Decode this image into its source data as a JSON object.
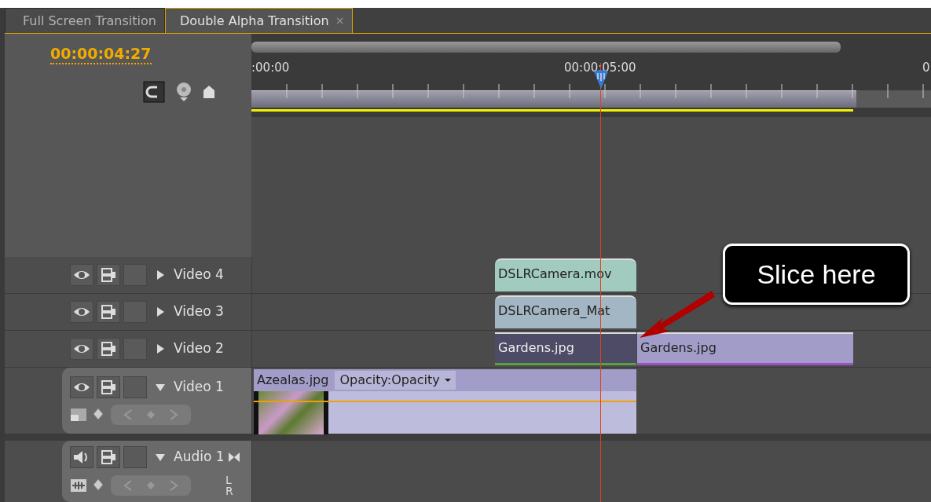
{
  "tabs": [
    {
      "label": "Full Screen Transition",
      "selected": false
    },
    {
      "label": "Double Alpha Transition",
      "selected": true,
      "close": "×"
    }
  ],
  "timecode": "00:00:04:27",
  "ruler_labels": [
    ":00:00",
    "00:00:05:00",
    "0"
  ],
  "tracks": [
    {
      "kind": "video",
      "name": "Video 4",
      "expanded": false,
      "clips": [
        {
          "name": "DSLRCamera.mov",
          "color": "#a2cbbf",
          "selected": false
        }
      ]
    },
    {
      "kind": "video",
      "name": "Video 3",
      "expanded": false,
      "clips": [
        {
          "name": "DSLRCamera_Mat",
          "color": "#a3b6c3",
          "selected": false
        }
      ]
    },
    {
      "kind": "video",
      "name": "Video 2",
      "expanded": false,
      "clips": [
        {
          "name": "Gardens.jpg",
          "color": "#4e4b66",
          "selected": true
        },
        {
          "name": "Gardens.jpg",
          "color": "#a19dc8",
          "selected": false
        }
      ]
    },
    {
      "kind": "video",
      "name": "Video 1",
      "expanded": true,
      "clips": [
        {
          "name": "Azealas.jpg",
          "color": "#a19dc8",
          "selected": false,
          "effect": "Opacity:Opacity"
        }
      ]
    },
    {
      "kind": "audio",
      "name": "Audio 1",
      "expanded": true,
      "channels": [
        "L",
        "R"
      ]
    }
  ],
  "callout": {
    "text": "Slice here"
  }
}
